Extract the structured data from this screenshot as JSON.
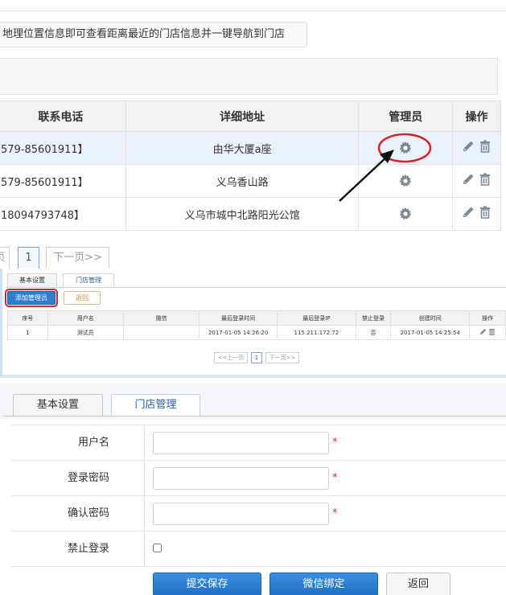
{
  "colors": {
    "primary_blue": "#1f6fc4",
    "highlight_row": "#eaf1fb",
    "annotation_red": "#d8232a",
    "required_star": "#d23030"
  },
  "store_list": {
    "notice": "地理位置信息即可查看距离最近的门店信息并一键导航到门店",
    "columns": {
      "phone": "联系电话",
      "address": "详细地址",
      "admin": "管理员",
      "actions": "操作"
    },
    "rows": [
      {
        "phone": "579-85601911】",
        "address": "由华大厦a座",
        "admin_icon": "gear-icon",
        "action_icons": [
          "pencil-icon",
          "trash-icon"
        ]
      },
      {
        "phone": "579-85601911】",
        "address": "义乌香山路",
        "admin_icon": "gear-icon",
        "action_icons": [
          "pencil-icon",
          "trash-icon"
        ]
      },
      {
        "phone": "18094793748】",
        "address": "义乌市城中北路阳光公馆",
        "admin_icon": "gear-icon",
        "action_icons": [
          "pencil-icon",
          "trash-icon"
        ]
      }
    ],
    "pagination": {
      "prev": "页",
      "current": "1",
      "next": "下一页>>"
    }
  },
  "admin_list": {
    "tabs": [
      "基本设置",
      "门店管理"
    ],
    "add_button": "添加管理员",
    "back_button": "返回",
    "columns": [
      "序号",
      "用户名",
      "微信",
      "最后登录时间",
      "最后登录IP",
      "禁止登录",
      "创建时间",
      "操作"
    ],
    "rows": [
      {
        "index": "1",
        "username": "测试员",
        "wechat": "",
        "last_login_time": "2017-01-05 14:26:20",
        "last_login_ip": "115.211.172.72",
        "banned": "否",
        "created": "2017-01-05 14:25:54"
      }
    ],
    "pagination": {
      "prev": "<<上一页",
      "current": "1",
      "next": "下一页>>"
    }
  },
  "admin_form": {
    "tabs": [
      "基本设置",
      "门店管理"
    ],
    "fields": {
      "username": {
        "label": "用户名",
        "value": "",
        "required_mark": "*"
      },
      "password": {
        "label": "登录密码",
        "value": "",
        "required_mark": "*"
      },
      "confirm": {
        "label": "确认密码",
        "value": "",
        "required_mark": "*"
      },
      "ban_login": {
        "label": "禁止登录",
        "checked": false
      }
    },
    "buttons": {
      "submit": "提交保存",
      "wechat_bind": "微信绑定",
      "back": "返回"
    }
  }
}
